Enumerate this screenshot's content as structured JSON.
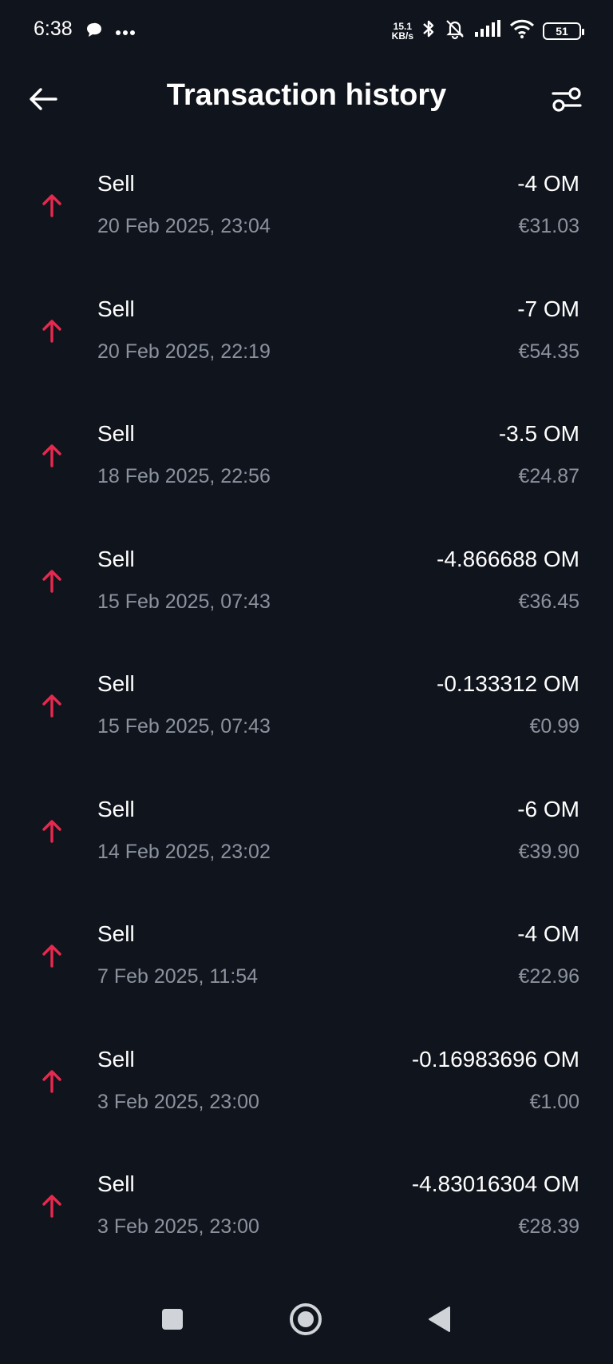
{
  "status_bar": {
    "time": "6:38",
    "net_speed_value": "15.1",
    "net_speed_unit": "KB/s",
    "battery": "51",
    "icons": [
      "chat-bubble-icon",
      "more-dots-icon",
      "bluetooth-icon",
      "bell-muted-icon",
      "signal-icon",
      "wifi-icon",
      "battery-icon"
    ]
  },
  "header": {
    "title": "Transaction history",
    "back_icon": "arrow-left-icon",
    "filter_icon": "filter-sliders-icon"
  },
  "colors": {
    "background": "#10141c",
    "primary_text": "#ffffff",
    "secondary_text": "#8b929e",
    "sell_arrow": "#e8294f"
  },
  "transactions": [
    {
      "type": "Sell",
      "date": "20 Feb 2025, 23:04",
      "amount": "-4 OM",
      "fiat": "€31.03"
    },
    {
      "type": "Sell",
      "date": "20 Feb 2025, 22:19",
      "amount": "-7 OM",
      "fiat": "€54.35"
    },
    {
      "type": "Sell",
      "date": "18 Feb 2025, 22:56",
      "amount": "-3.5 OM",
      "fiat": "€24.87"
    },
    {
      "type": "Sell",
      "date": "15 Feb 2025, 07:43",
      "amount": "-4.866688 OM",
      "fiat": "€36.45"
    },
    {
      "type": "Sell",
      "date": "15 Feb 2025, 07:43",
      "amount": "-0.133312 OM",
      "fiat": "€0.99"
    },
    {
      "type": "Sell",
      "date": "14 Feb 2025, 23:02",
      "amount": "-6 OM",
      "fiat": "€39.90"
    },
    {
      "type": "Sell",
      "date": "7 Feb 2025, 11:54",
      "amount": "-4 OM",
      "fiat": "€22.96"
    },
    {
      "type": "Sell",
      "date": "3 Feb 2025, 23:00",
      "amount": "-0.16983696 OM",
      "fiat": "€1.00"
    },
    {
      "type": "Sell",
      "date": "3 Feb 2025, 23:00",
      "amount": "-4.83016304 OM",
      "fiat": "€28.39"
    }
  ],
  "nav_bar": {
    "icons": [
      "recents-square-icon",
      "home-circle-icon",
      "back-triangle-icon"
    ]
  }
}
